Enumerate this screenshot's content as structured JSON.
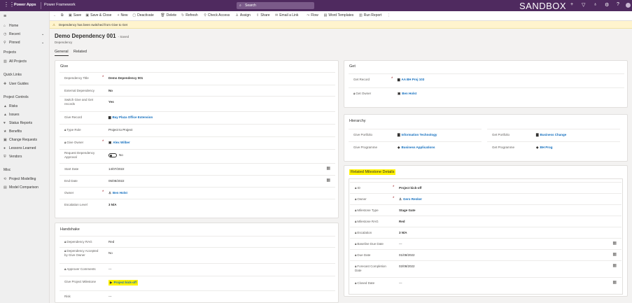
{
  "topbar": {
    "brand": "Power Apps",
    "app": "Power Framework",
    "search_placeholder": "Search",
    "environment": "SANDBOX",
    "icons": [
      "plus-icon",
      "filter-icon",
      "lightbulb-icon",
      "gear-icon",
      "help-icon",
      "avatar-icon"
    ]
  },
  "commands": [
    {
      "icon": "back-icon",
      "glyph": "←",
      "label": ""
    },
    {
      "icon": "popout-icon",
      "glyph": "⧉",
      "label": ""
    },
    {
      "icon": "save-icon",
      "glyph": "▣",
      "label": "Save"
    },
    {
      "icon": "save-close-icon",
      "glyph": "▣",
      "label": "Save & Close"
    },
    {
      "icon": "new-icon",
      "glyph": "+",
      "label": "New"
    },
    {
      "icon": "deactivate-icon",
      "glyph": "▢",
      "label": "Deactivate"
    },
    {
      "icon": "delete-icon",
      "glyph": "🗑",
      "label": "Delete"
    },
    {
      "icon": "refresh-icon",
      "glyph": "↻",
      "label": "Refresh"
    },
    {
      "icon": "check-access-icon",
      "glyph": "⚲",
      "label": "Check Access"
    },
    {
      "icon": "assign-icon",
      "glyph": "♙",
      "label": "Assign"
    },
    {
      "icon": "share-icon",
      "glyph": "⇪",
      "label": "Share"
    },
    {
      "icon": "email-icon",
      "glyph": "✉",
      "label": "Email a Link"
    },
    {
      "icon": "flow-icon",
      "glyph": "⤳",
      "label": "Flow"
    },
    {
      "icon": "word-icon",
      "glyph": "▤",
      "label": "Word Templates"
    },
    {
      "icon": "report-icon",
      "glyph": "▥",
      "label": "Run Report"
    },
    {
      "icon": "more-icon",
      "glyph": "⋮",
      "label": ""
    }
  ],
  "notice": "Dependency has been switched from Give to Get",
  "nav": {
    "items": [
      {
        "id": "home",
        "icon": "home-icon",
        "glyph": "⌂",
        "label": "Home"
      },
      {
        "id": "recent",
        "icon": "clock-icon",
        "glyph": "◷",
        "label": "Recent"
      },
      {
        "id": "pinned",
        "icon": "pin-icon",
        "glyph": "⚲",
        "label": "Pinned"
      }
    ],
    "sections": [
      {
        "title": "Projects",
        "items": [
          {
            "id": "all-projects",
            "icon": "projects-icon",
            "glyph": "▥",
            "label": "All Projects"
          }
        ]
      },
      {
        "title": "Quick Links",
        "items": [
          {
            "id": "user-guides",
            "icon": "book-icon",
            "glyph": "✚",
            "label": "User Guides"
          }
        ]
      },
      {
        "title": "Project Controls",
        "items": [
          {
            "id": "risks",
            "icon": "warning-icon",
            "glyph": "▲",
            "label": "Risks"
          },
          {
            "id": "issues",
            "icon": "warning-icon",
            "glyph": "▲",
            "label": "Issues"
          },
          {
            "id": "status-reports",
            "icon": "heart-icon",
            "glyph": "♥",
            "label": "Status Reports"
          },
          {
            "id": "benefits",
            "icon": "star-icon",
            "glyph": "★",
            "label": "Benefits"
          },
          {
            "id": "change-requests",
            "icon": "change-icon",
            "glyph": "▣",
            "label": "Change Requests"
          },
          {
            "id": "lessons-learned",
            "icon": "lesson-icon",
            "glyph": "●",
            "label": "Lessons Learned"
          },
          {
            "id": "vendors",
            "icon": "vendor-icon",
            "glyph": "⛨",
            "label": "Vendors"
          }
        ]
      },
      {
        "title": "Misc",
        "items": [
          {
            "id": "project-modelling",
            "icon": "model-icon",
            "glyph": "⟲",
            "label": "Project Modelling"
          },
          {
            "id": "model-comparison",
            "icon": "compare-icon",
            "glyph": "▤",
            "label": "Model Comparison"
          }
        ]
      }
    ]
  },
  "form": {
    "title": "Demo Dependency 001",
    "status": "- Saved",
    "entity": "Dependency",
    "tabs": [
      "General",
      "Related"
    ]
  },
  "give": {
    "title": "Give",
    "rows": [
      {
        "label": "Dependency Title",
        "req": true,
        "value": "Demo Dependency 001"
      },
      {
        "label": "External Dependency",
        "value": "No"
      },
      {
        "label": "Switch Give and Get records",
        "value": "Yes"
      },
      {
        "label": "Give Record",
        "value": "Bay Plaza Office Extension",
        "link": true,
        "icon": "project-icon"
      },
      {
        "label": "Type Role",
        "lock": true,
        "value": "Project to Project",
        "plain": true
      },
      {
        "label": "Give Owner",
        "lock": true,
        "req": true,
        "value": "Alex Wilber",
        "link": true,
        "icon": "user-icon"
      },
      {
        "label": "Request Dependency Approval",
        "value": "No",
        "toggle": true
      },
      {
        "label": "Start Date",
        "value": "14/07/2022",
        "plain": true,
        "cal": true
      },
      {
        "label": "End Date",
        "value": "05/08/2022",
        "plain": true,
        "cal": true
      },
      {
        "label": "Owner",
        "req": true,
        "value": "Ben Holst",
        "link": true,
        "icon": "person-icon"
      },
      {
        "label": "Escalation Level",
        "value": "3 N/A"
      }
    ]
  },
  "handshake": {
    "title": "Handshake",
    "rows": [
      {
        "label": "Dependency RAG",
        "lock": true,
        "value": "Red",
        "plain": true
      },
      {
        "label": "Dependency Accepted by Give Owner",
        "lock": true,
        "value": "No",
        "plain": true
      },
      {
        "label": "Approver Comments",
        "lock": true,
        "value": "---",
        "plain": true
      },
      {
        "label": "Give Project Milestone",
        "value": "Project kick-off",
        "link": true,
        "highlight": true
      },
      {
        "label": "Risk",
        "value": "---",
        "plain": true
      }
    ]
  },
  "get": {
    "title": "Get",
    "rows": [
      {
        "label": "Get Record",
        "req": true,
        "value": "AA BH Proj 103",
        "link": true,
        "icon": "project-icon"
      },
      {
        "label": "Get Owner",
        "lock": true,
        "value": "Ben Holst",
        "link": true,
        "icon": "user-icon"
      }
    ]
  },
  "hierarchy": {
    "title": "Hierarchy",
    "left": [
      {
        "label": "Give Portfolio",
        "value": "Information Technology",
        "link": true,
        "icon": "portfolio-icon"
      },
      {
        "label": "Give Programme",
        "value": "Business Applications",
        "link": true,
        "icon": "programme-icon"
      }
    ],
    "right": [
      {
        "label": "Get Portfolio",
        "value": "Business Change",
        "link": true,
        "icon": "portfolio-icon"
      },
      {
        "label": "Get Programme",
        "value": "BH Prog",
        "link": true,
        "icon": "programme-icon"
      }
    ]
  },
  "milestone": {
    "title": "Related Milestone Details",
    "rows": [
      {
        "label": "ID",
        "lock": true,
        "req": true,
        "value": "Project kick-off"
      },
      {
        "label": "Owner",
        "lock": true,
        "req": true,
        "value": "Gero Renker",
        "link": true,
        "icon": "person-icon"
      },
      {
        "label": "Milestone Type",
        "lock": true,
        "value": "Stage Gate"
      },
      {
        "label": "Milestone RAG",
        "lock": true,
        "value": "Red"
      },
      {
        "label": "Escalation",
        "lock": true,
        "value": "3 N/A"
      },
      {
        "label": "Baseline Due Date",
        "lock": true,
        "value": "---",
        "plain": true,
        "cal": true
      },
      {
        "label": "Due Date",
        "lock": true,
        "value": "01/08/2022",
        "plain": true,
        "cal": true
      },
      {
        "label": "Forecast Completion Date",
        "lock": true,
        "value": "02/08/2022",
        "plain": true,
        "cal": true
      },
      {
        "label": "Closed Date",
        "lock": true,
        "value": "---",
        "plain": true,
        "cal": true
      }
    ]
  }
}
